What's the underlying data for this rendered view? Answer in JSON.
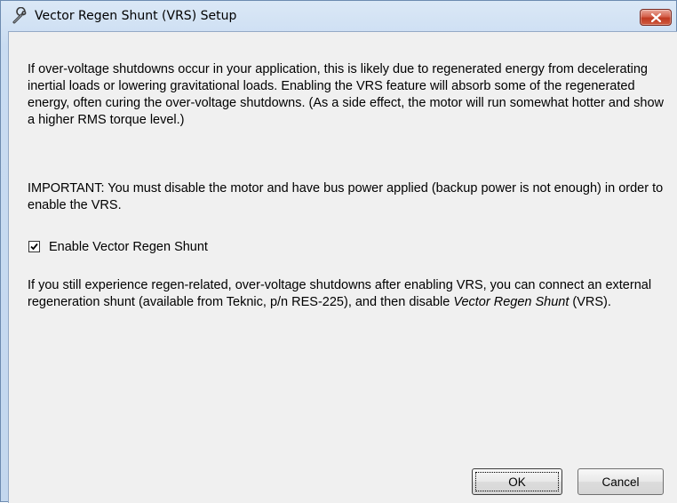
{
  "window": {
    "title": "Vector Regen Shunt (VRS) Setup",
    "title_icon": "wrench-icon",
    "close_icon": "close-icon",
    "close_button_color": "#c74b32"
  },
  "content": {
    "paragraph_1": "If over-voltage shutdowns occur in your application, this is likely due to regenerated energy from decelerating inertial loads or lowering gravitational loads.  Enabling the VRS feature will absorb some of the regenerated energy, often curing the over-voltage shutdowns.  (As a side effect, the motor will run somewhat hotter and show a higher RMS torque level.)",
    "paragraph_2": "IMPORTANT: You must disable the motor and have bus power applied (backup power is not enough) in order to enable the VRS.",
    "checkbox": {
      "label": "Enable Vector Regen Shunt",
      "checked": true
    },
    "paragraph_3_before": "If you still experience regen-related, over-voltage shutdowns after enabling VRS, you can connect an external regeneration shunt (available from Teknic, p/n RES-225), and then disable ",
    "paragraph_3_italic": "Vector Regen Shunt",
    "paragraph_3_after": " (VRS)."
  },
  "buttons": {
    "ok_label": "OK",
    "cancel_label": "Cancel"
  }
}
